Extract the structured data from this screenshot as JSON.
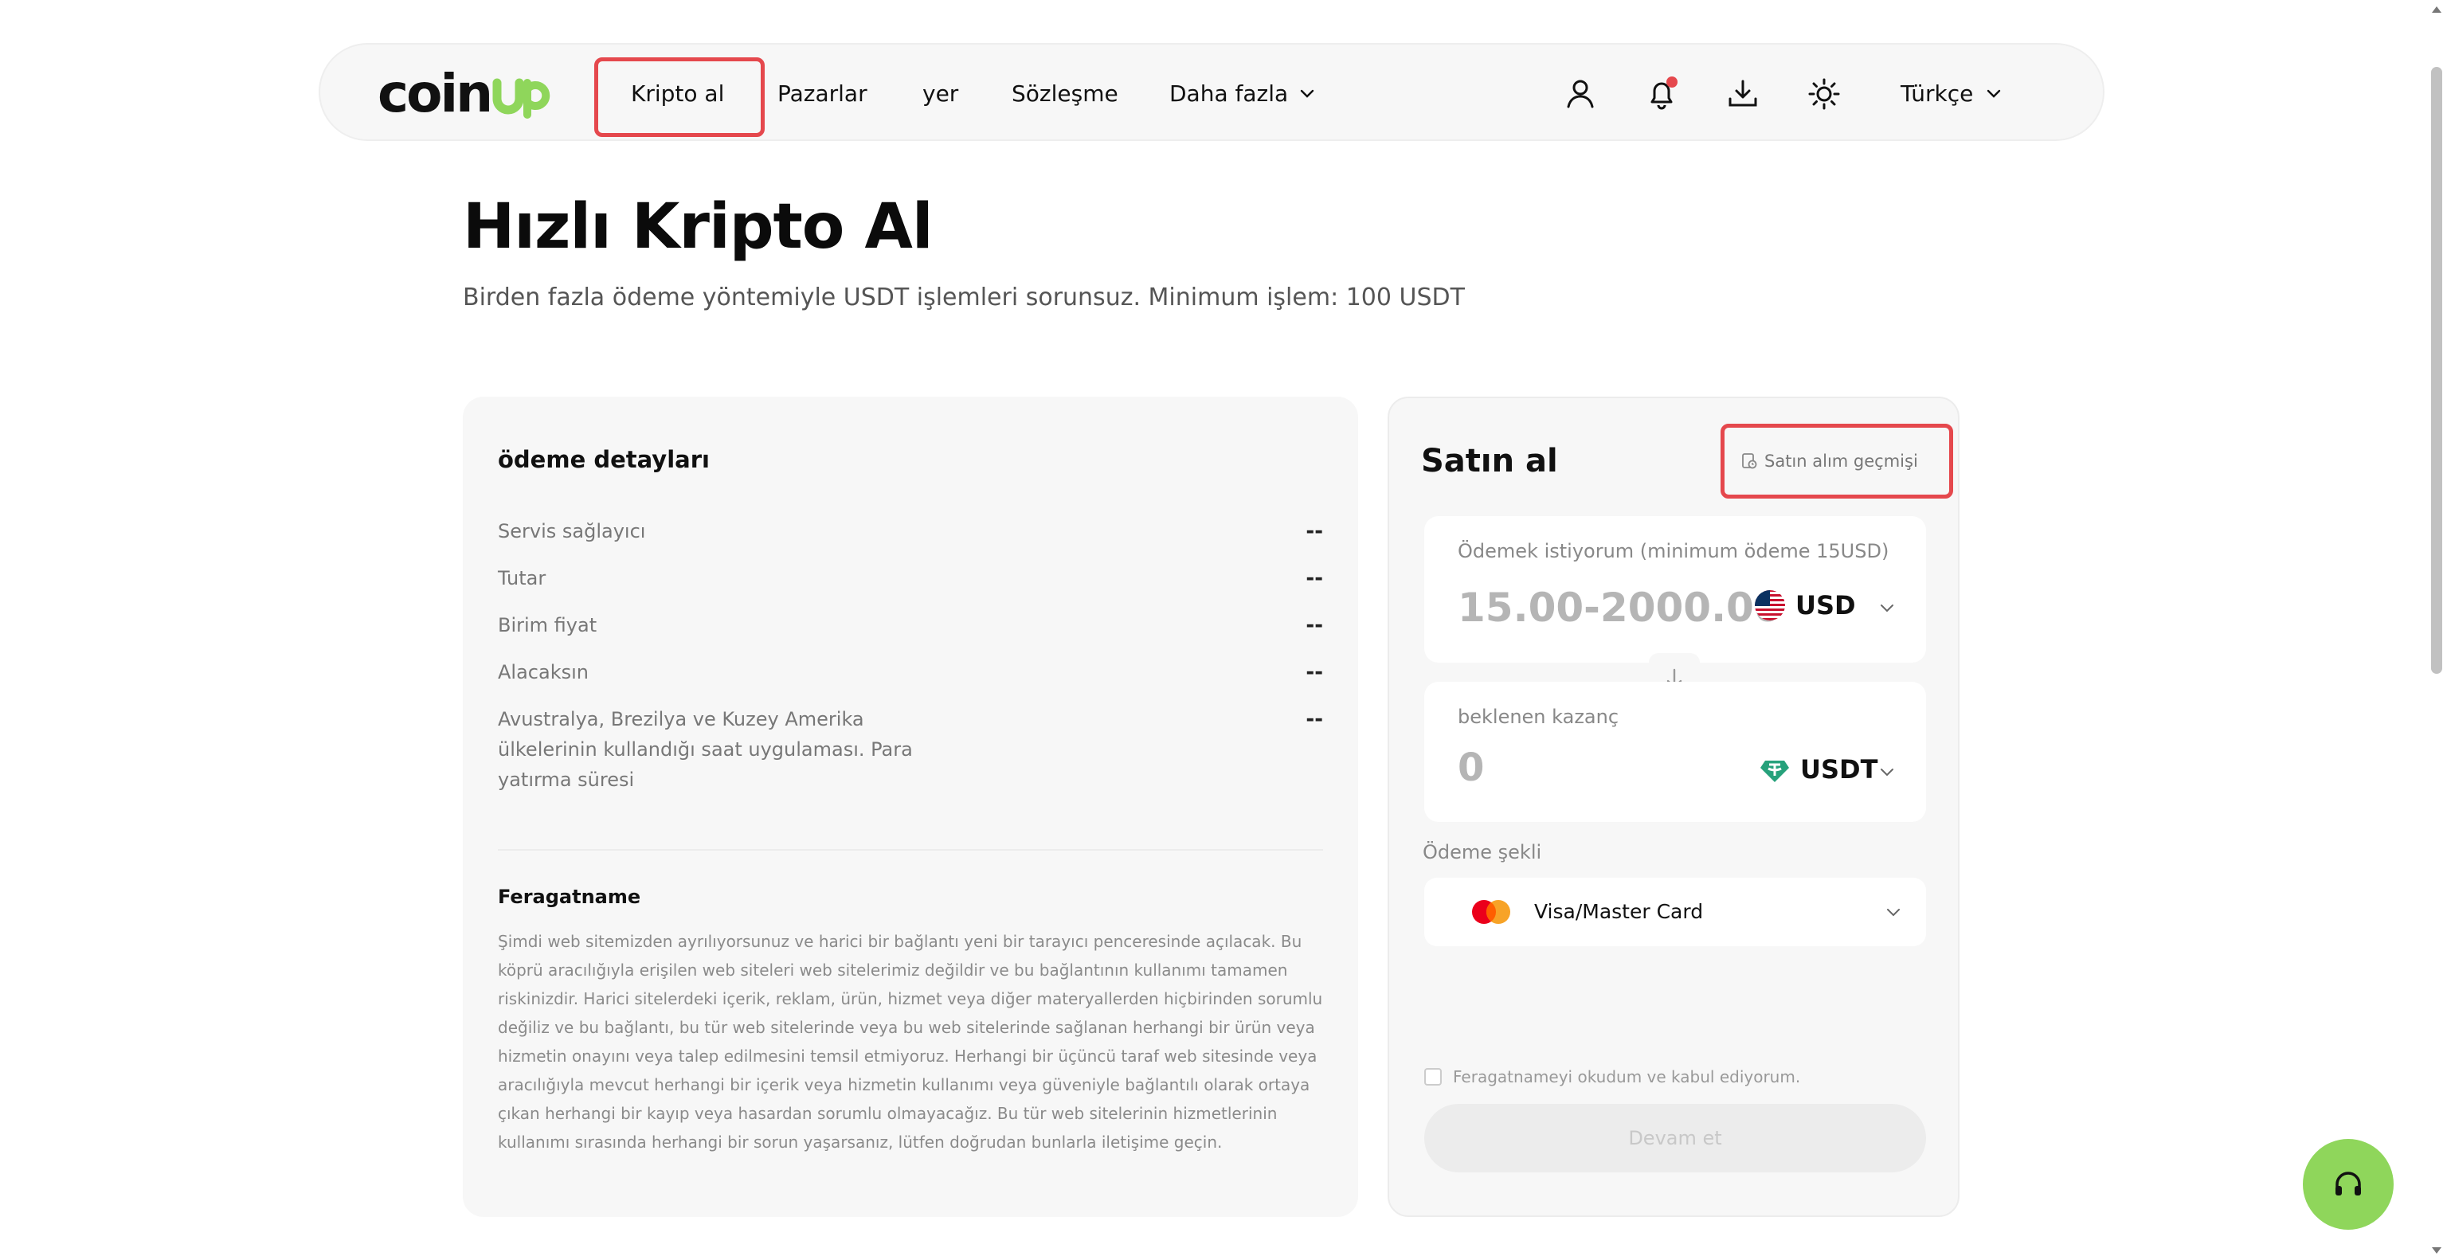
{
  "nav": {
    "logo_text": "coinup",
    "items": [
      {
        "label": "Kripto al"
      },
      {
        "label": "Pazarlar"
      },
      {
        "label": "yer"
      },
      {
        "label": "Sözleşme"
      },
      {
        "label": "Daha fazla"
      }
    ],
    "language": "Türkçe",
    "icons": [
      "user-icon",
      "bell-icon",
      "download-icon",
      "theme-sun-icon"
    ]
  },
  "hero": {
    "title": "Hızlı Kripto Al",
    "subtitle": "Birden fazla ödeme yöntemiyle USDT işlemleri sorunsuz. Minimum işlem: 100 USDT"
  },
  "details": {
    "title": "ödeme detayları",
    "rows": [
      {
        "label": "Servis sağlayıcı",
        "value": "--"
      },
      {
        "label": "Tutar",
        "value": "--"
      },
      {
        "label": "Birim fiyat",
        "value": "--"
      },
      {
        "label": "Alacaksın",
        "value": "--"
      },
      {
        "label": "Avustralya, Brezilya ve Kuzey Amerika ülkelerinin kullandığı saat uygulaması. Para yatırma süresi",
        "value": "--"
      }
    ],
    "disclaimer_title": "Feragatname",
    "disclaimer_text": "Şimdi web sitemizden ayrılıyorsunuz ve harici bir bağlantı yeni bir tarayıcı penceresinde açılacak. Bu köprü aracılığıyla erişilen web siteleri web sitelerimiz değildir ve bu bağlantının kullanımı tamamen riskinizdir. Harici sitelerdeki içerik, reklam, ürün, hizmet veya diğer materyallerden hiçbirinden sorumlu değiliz ve bu bağlantı, bu tür web sitelerinde veya bu web sitelerinde sağlanan herhangi bir ürün veya hizmetin onayını veya talep edilmesini temsil etmiyoruz. Herhangi bir üçüncü taraf web sitesinde veya aracılığıyla mevcut herhangi bir içerik veya hizmetin kullanımı veya güveniyle bağlantılı olarak ortaya çıkan herhangi bir kayıp veya hasardan sorumlu olmayacağız. Bu tür web sitelerinin hizmetlerinin kullanımı sırasında herhangi bir sorun yaşarsanız, lütfen doğrudan bunlarla iletişime geçin."
  },
  "buy": {
    "title": "Satın al",
    "history_label": "Satın alım geçmişi",
    "pay_label": "Ödemek istiyorum (minimum ödeme 15USD)",
    "pay_placeholder": "15.00-2000.00",
    "pay_currency": "USD",
    "receive_label": "beklenen kazanç",
    "receive_value": "0",
    "receive_currency": "USDT",
    "method_label": "Ödeme şekli",
    "method_value": "Visa/Master Card",
    "agree_label": "Feragatnameyi okudum ve kabul ediyorum.",
    "continue_label": "Devam et"
  },
  "colors": {
    "brand_green": "#8fd65b",
    "highlight_red": "#e5484d",
    "tether_green": "#26a17b"
  }
}
